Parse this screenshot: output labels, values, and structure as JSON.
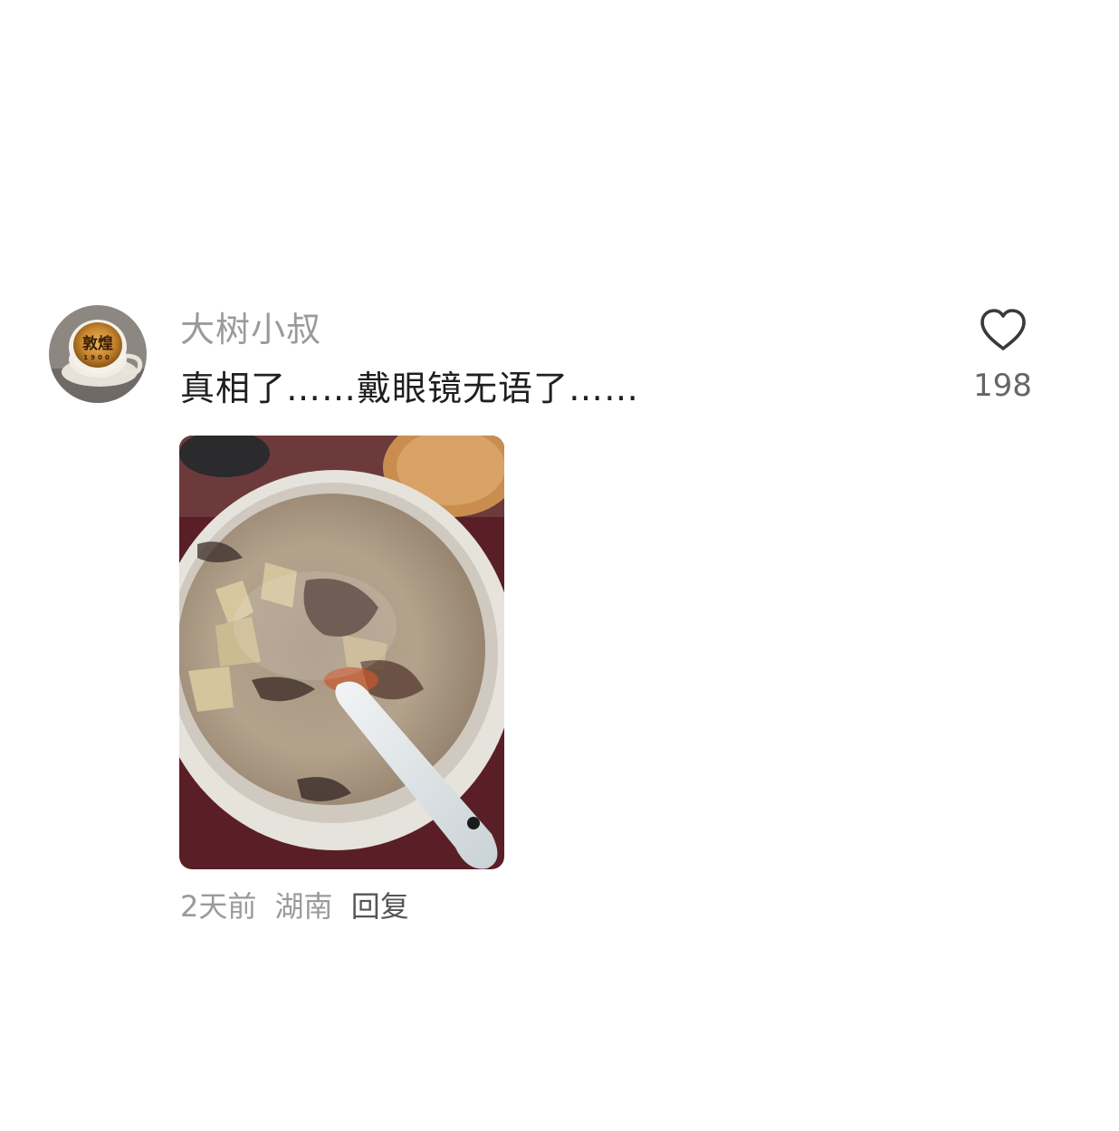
{
  "comment": {
    "username": "大树小叔",
    "text": "真相了……戴眼镜无语了……",
    "likes": "198",
    "time": "2天前",
    "location": "湖南",
    "reply_label": "回复"
  },
  "avatar": {
    "logo_text": "敦煌",
    "logo_subtext": "1900"
  },
  "icons": {
    "like": "heart-outline-icon"
  }
}
